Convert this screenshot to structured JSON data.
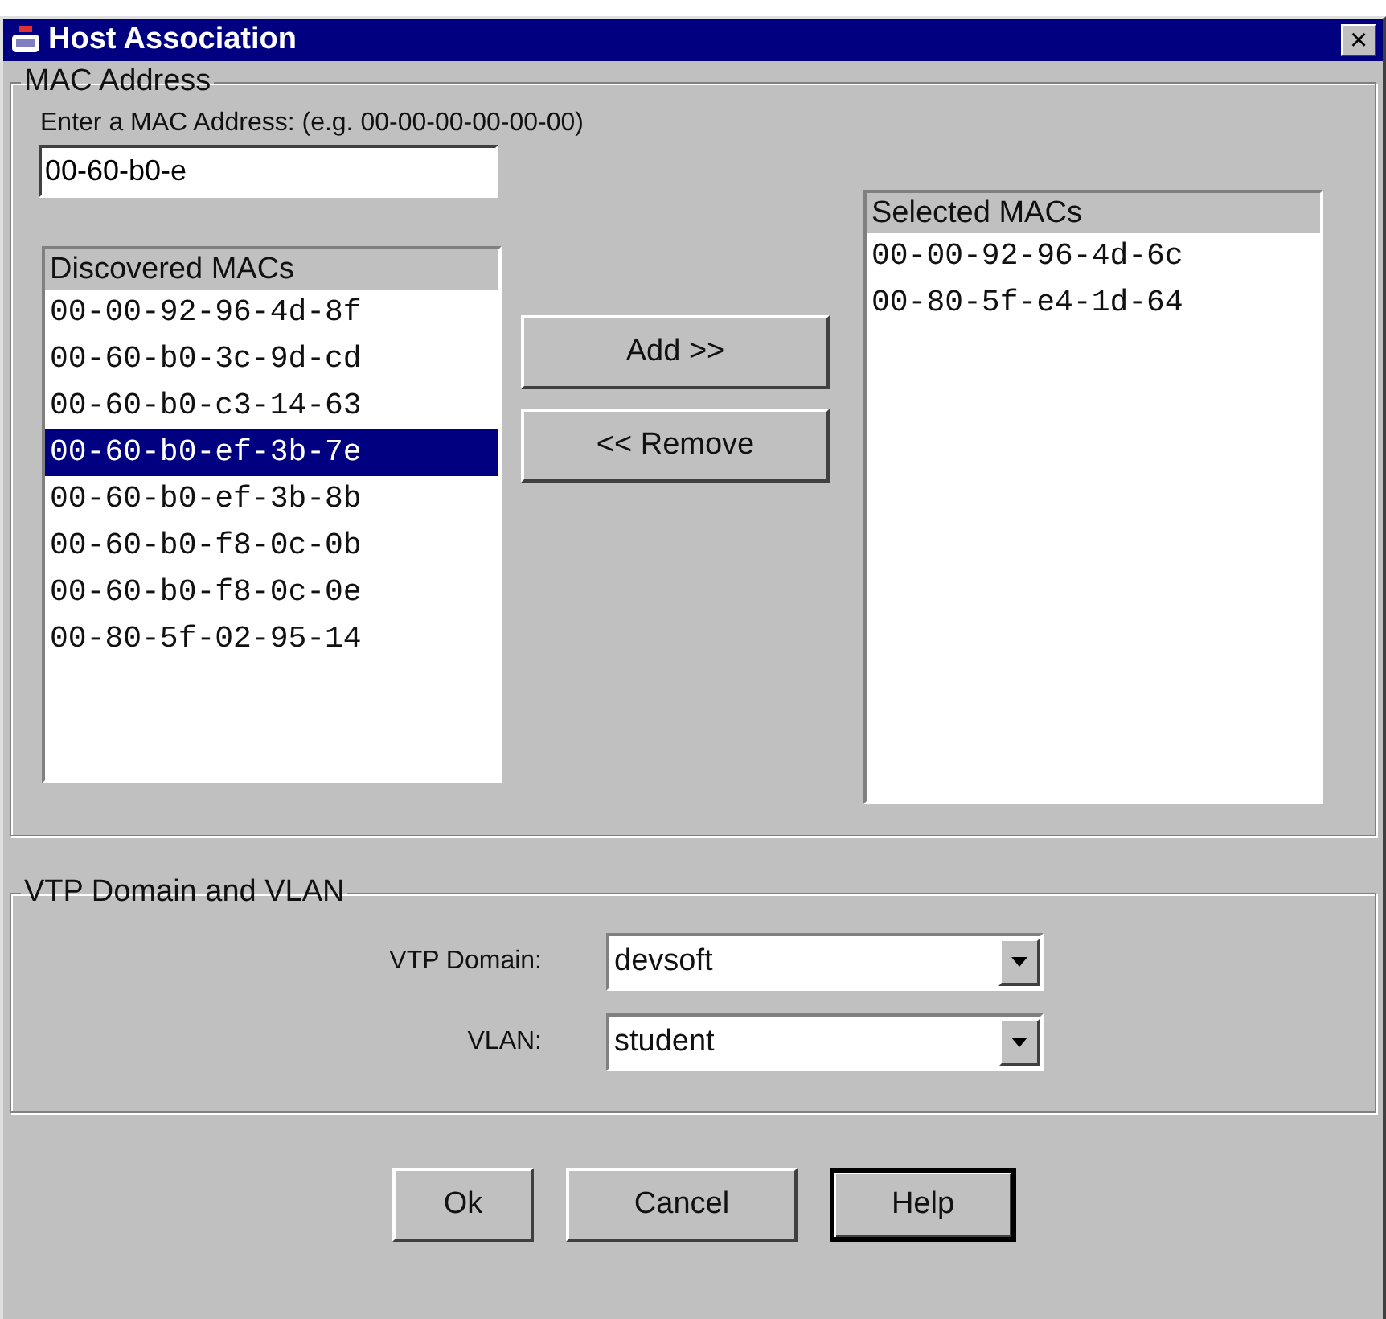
{
  "window": {
    "title": "Host Association",
    "close": "×"
  },
  "mac_group": {
    "legend": "MAC Address",
    "prompt": "Enter a MAC Address: (e.g. 00-00-00-00-00-00)",
    "mac_field": {
      "value": "00-60-b0-e"
    },
    "discovered": {
      "header": "Discovered MACs",
      "items": [
        {
          "text": "00-00-92-96-4d-8f",
          "selected": false
        },
        {
          "text": "00-60-b0-3c-9d-cd",
          "selected": false
        },
        {
          "text": "00-60-b0-c3-14-63",
          "selected": false
        },
        {
          "text": "00-60-b0-ef-3b-7e",
          "selected": true
        },
        {
          "text": "00-60-b0-ef-3b-8b",
          "selected": false
        },
        {
          "text": "00-60-b0-f8-0c-0b",
          "selected": false
        },
        {
          "text": "00-60-b0-f8-0c-0e",
          "selected": false
        },
        {
          "text": "00-80-5f-02-95-14",
          "selected": false
        }
      ]
    },
    "move_buttons": [
      "Add >>",
      "<< Remove"
    ],
    "selected_macs": {
      "header": "Selected MACs",
      "items": [
        {
          "text": "00-00-92-96-4d-6c",
          "selected": false
        },
        {
          "text": "00-80-5f-e4-1d-64",
          "selected": false
        }
      ]
    }
  },
  "vtp_group": {
    "legend": "VTP Domain and VLAN",
    "fields": [
      {
        "label": "VTP Domain:",
        "value": "devsoft"
      },
      {
        "label": "VLAN:",
        "value": "student"
      }
    ]
  },
  "buttons": [
    {
      "label": "Ok",
      "default": false
    },
    {
      "label": "Cancel",
      "default": false
    },
    {
      "label": "Help",
      "default": true
    }
  ]
}
